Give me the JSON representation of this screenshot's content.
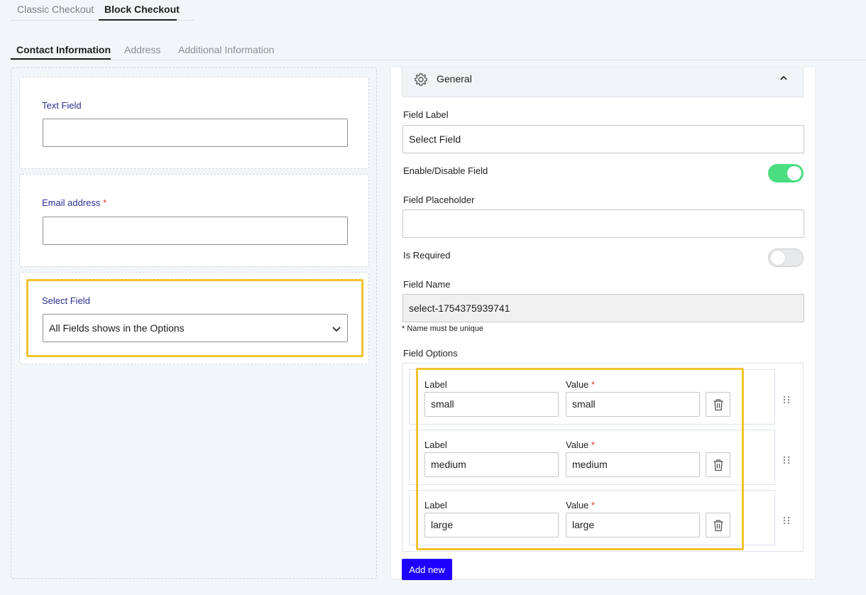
{
  "top_tabs": [
    {
      "label": "Classic Checkout",
      "active": false
    },
    {
      "label": "Block Checkout",
      "active": true
    }
  ],
  "section_tabs": [
    {
      "label": "Contact Information",
      "active": true
    },
    {
      "label": "Address",
      "active": false
    },
    {
      "label": "Additional Information",
      "active": false
    }
  ],
  "builder": {
    "fields": [
      {
        "label": "Text Field",
        "required": false,
        "type": "text",
        "value": ""
      },
      {
        "label": "Email address",
        "required": true,
        "type": "text",
        "value": ""
      },
      {
        "label": "Select Field",
        "required": false,
        "type": "select",
        "value": "All Fields shows in the Options"
      }
    ],
    "required_marker": "*"
  },
  "settings": {
    "section_title": "General",
    "field_label": {
      "label": "Field Label",
      "value": "Select Field"
    },
    "enable_disable": {
      "label": "Enable/Disable Field",
      "on": true
    },
    "placeholder": {
      "label": "Field Placeholder",
      "value": ""
    },
    "is_required": {
      "label": "Is Required",
      "on": false
    },
    "field_name": {
      "label": "Field Name",
      "value": "select-1754375939741",
      "note": "* Name must be unique"
    },
    "options_title": "Field Options",
    "option_label_heading": "Label",
    "option_value_heading": "Value",
    "options": [
      {
        "label": "small",
        "value": "small"
      },
      {
        "label": "medium",
        "value": "medium"
      },
      {
        "label": "large",
        "value": "large"
      }
    ],
    "add_new_label": "Add new"
  },
  "colors": {
    "accent_button": "#1f00ff",
    "toggle_on": "#4ade80",
    "highlight": "#f0c330",
    "field_label": "#2b2f8f",
    "required": "#d63638"
  }
}
